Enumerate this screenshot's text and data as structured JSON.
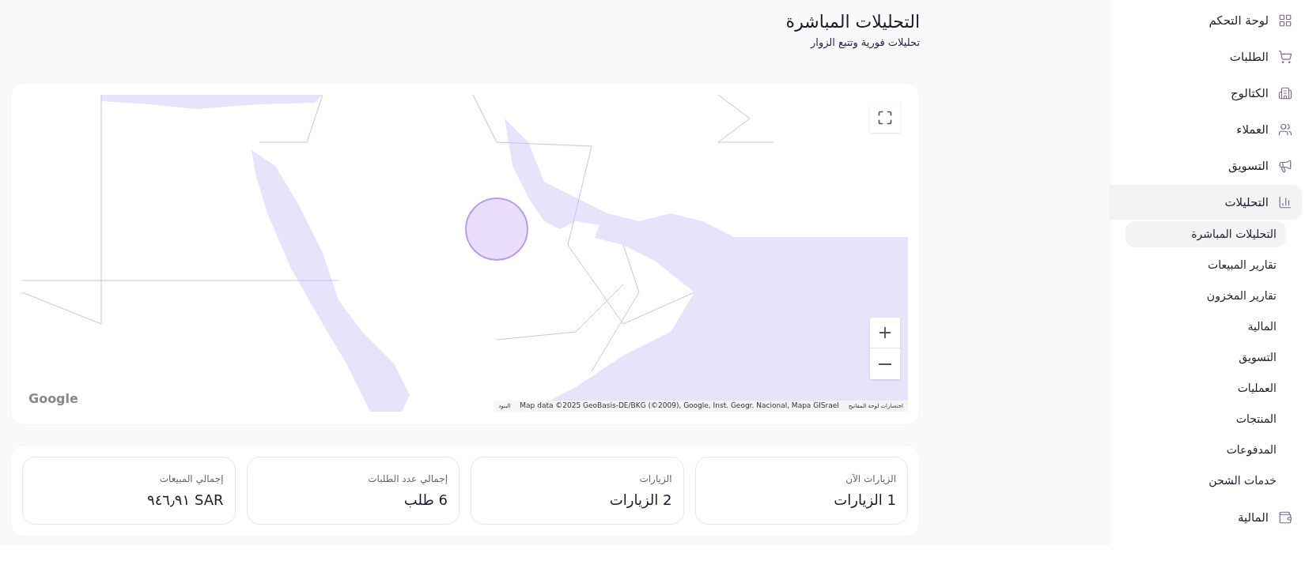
{
  "page": {
    "title": "التحليلات المباشرة",
    "subtitle": "تحليلات فورية وتتبع الزوار"
  },
  "map": {
    "logo": "Google",
    "attribution": [
      {
        "kind": "shortcuts",
        "text": "اختصارات لوحة المفاتيح"
      },
      {
        "kind": "data",
        "text": "Map data ©2025 GeoBasis-DE/BKG (©2009), Google, Inst. Geogr. Nacional, Mapa GISrael"
      },
      {
        "kind": "terms",
        "text": "البنود"
      }
    ]
  },
  "stats": [
    {
      "label": "الزيارات الآن",
      "value": "1 الزيارات"
    },
    {
      "label": "الزيارات",
      "value": "2 الزيارات"
    },
    {
      "label": "إجمالي عدد الطلبات",
      "value": "6 طلب"
    },
    {
      "label": "إجمالي المبيعات",
      "value": "SAR ٩٤٦٫٩١"
    }
  ],
  "sidebar": {
    "items": [
      {
        "label": "لوحة التحكم",
        "selected": false
      },
      {
        "label": "الطلبات",
        "selected": false
      },
      {
        "label": "الكتالوج",
        "selected": false
      },
      {
        "label": "العملاء",
        "selected": false
      },
      {
        "label": "التسويق",
        "selected": false
      },
      {
        "label": "التحليلات",
        "selected": true,
        "children": [
          {
            "label": "التحليلات المباشرة",
            "selected": true
          },
          {
            "label": "تقارير المبيعات",
            "selected": false
          },
          {
            "label": "تقارير المخزون",
            "selected": false
          },
          {
            "label": "المالية",
            "selected": false
          },
          {
            "label": "التسويق",
            "selected": false
          },
          {
            "label": "العمليات",
            "selected": false
          },
          {
            "label": "المنتجات",
            "selected": false
          },
          {
            "label": "المدفوعات",
            "selected": false
          },
          {
            "label": "خدمات الشحن",
            "selected": false
          }
        ]
      },
      {
        "label": "المالية",
        "selected": false
      }
    ]
  }
}
